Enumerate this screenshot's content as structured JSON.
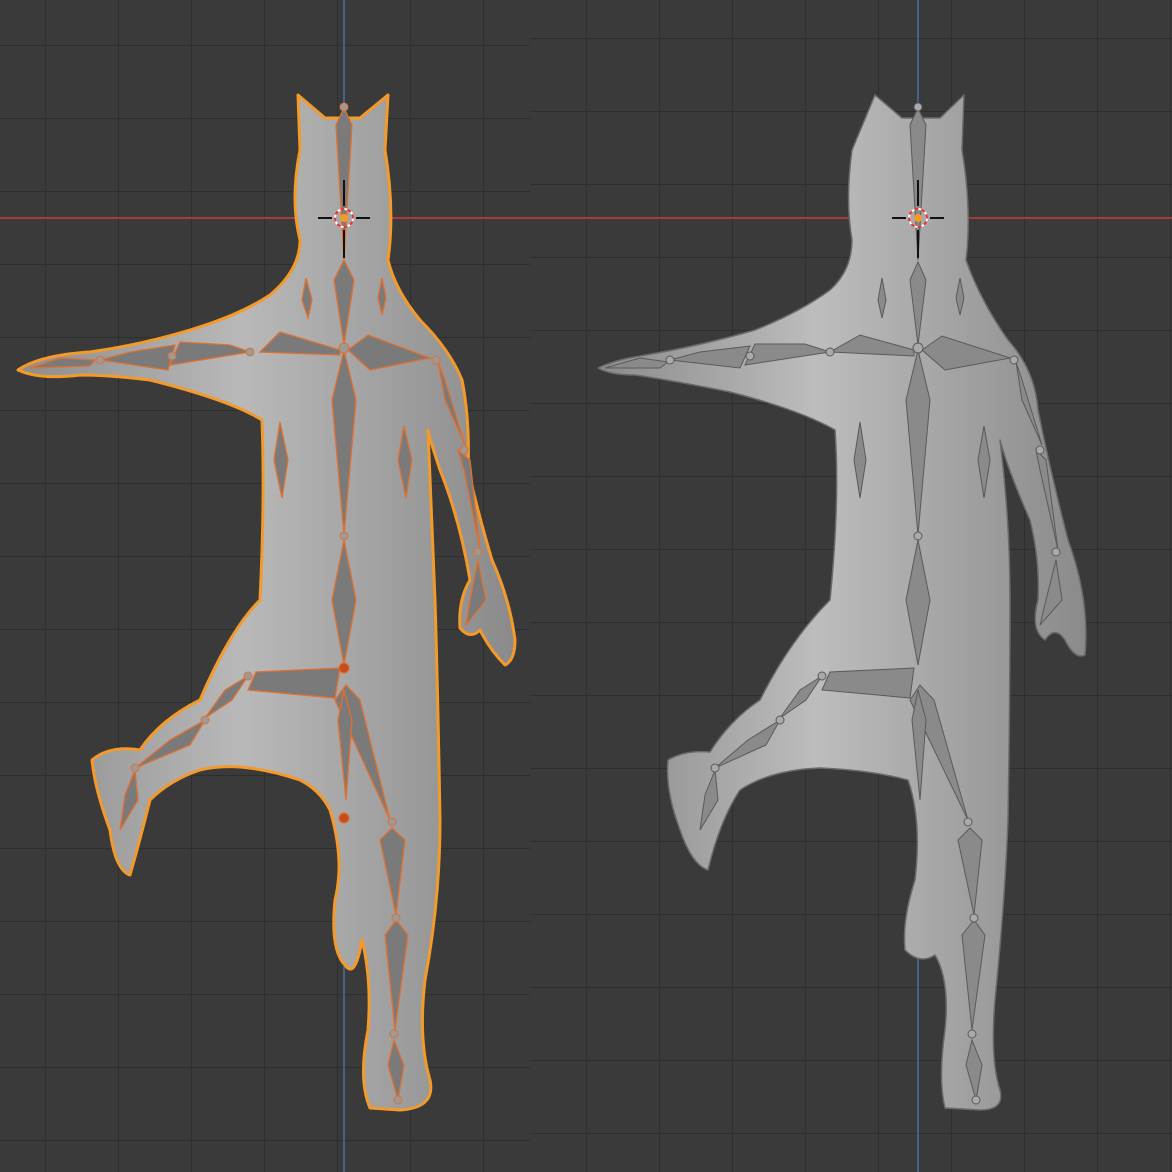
{
  "viewports": [
    {
      "id": "left",
      "shading": "solid",
      "mode": "pose-mode",
      "selection": "armature-selected",
      "accent_color": "#f39a2a",
      "axis_x_color": "#a83a3a",
      "axis_y_color": "#4a6fa8"
    },
    {
      "id": "right",
      "shading": "solid",
      "mode": "object-mode",
      "selection": "none",
      "axis_x_color": "#a83a3a",
      "axis_y_color": "#4a6fa8"
    }
  ],
  "icons": [
    "3d-cursor-icon",
    "armature-icon",
    "character-mesh-icon"
  ],
  "colors": {
    "background": "#393939",
    "grid": "#2e2e2e",
    "mesh": "#a8a8a8",
    "selection_outline": "#f39a2a",
    "bone_outline": "#e07030"
  }
}
